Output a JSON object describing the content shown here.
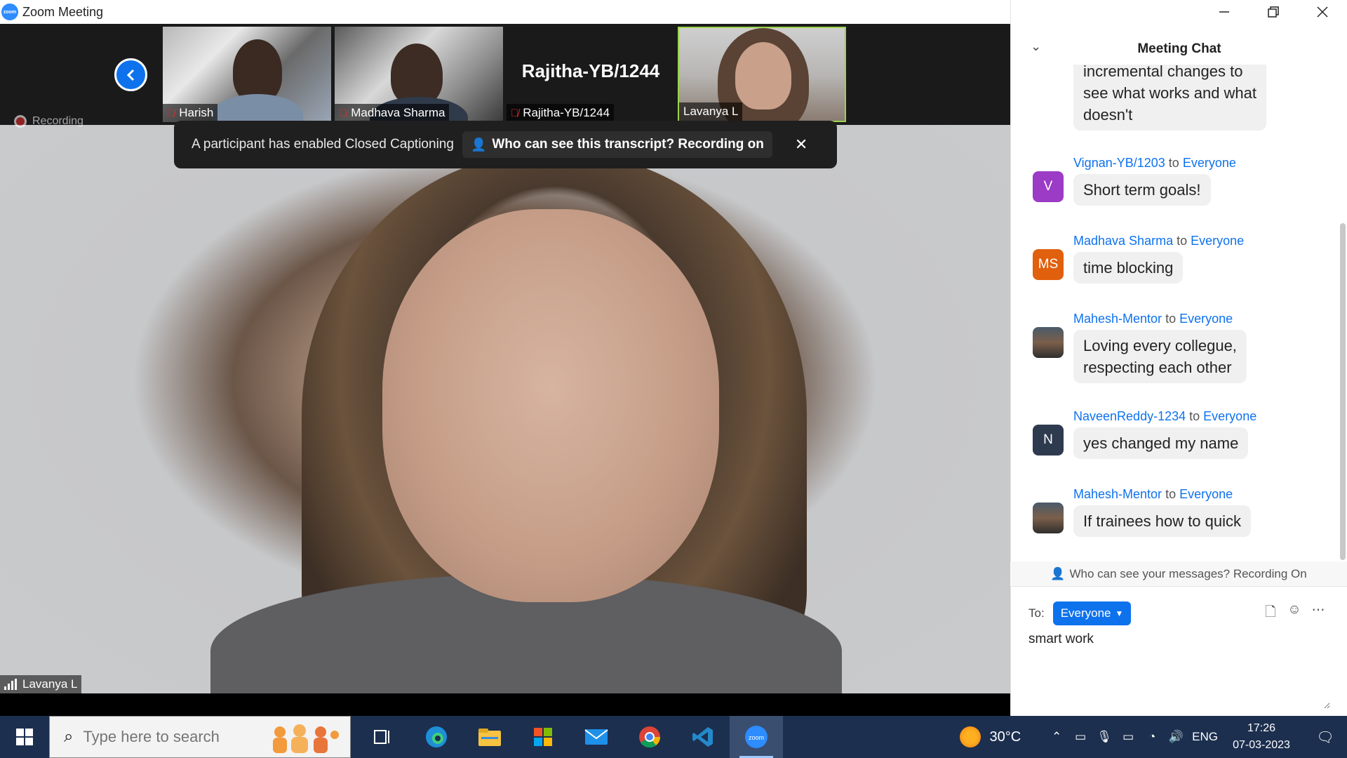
{
  "window": {
    "title": "Zoom Meeting",
    "logo_text": "zoom"
  },
  "participants": [
    {
      "name": "Harish",
      "muted": true
    },
    {
      "name": "Madhava Sharma",
      "muted": true
    },
    {
      "name": "Rajitha-YB/1244",
      "muted": true
    },
    {
      "name": "Lavanya L",
      "muted": false
    }
  ],
  "main_video": {
    "speaker": "Lavanya L",
    "recording_label": "Recording"
  },
  "cc_banner": {
    "text": "A participant has enabled Closed Captioning",
    "pill": "Who can see this transcript? Recording on"
  },
  "chat": {
    "title": "Meeting Chat",
    "messages": [
      {
        "sender": "",
        "to": "",
        "avatar": "",
        "lines": [
          "incremental changes to",
          "see what works  and what",
          "doesn't"
        ]
      },
      {
        "sender": "Vignan-YB/1203",
        "to": "Everyone",
        "avatar": "V",
        "avatar_color": "#9b3bc6",
        "lines": [
          "Short term goals!"
        ]
      },
      {
        "sender": "Madhava Sharma",
        "to": "Everyone",
        "avatar": "MS",
        "avatar_color": "#e0600e",
        "lines": [
          "time blocking"
        ]
      },
      {
        "sender": "Mahesh-Mentor",
        "to": "Everyone",
        "avatar": "",
        "lines": [
          "Loving every collegue,",
          "respecting each other"
        ]
      },
      {
        "sender": "NaveenReddy-1234",
        "to": "Everyone",
        "avatar": "N",
        "avatar_color": "#2e3a4e",
        "lines": [
          "yes changed my name"
        ]
      },
      {
        "sender": "Mahesh-Mentor",
        "to": "Everyone",
        "avatar": "",
        "lines": [
          "If trainees how to quick"
        ]
      }
    ],
    "to_word": "to",
    "privacy_note": "Who can see your messages? Recording On",
    "to_label": "To:",
    "to_value": "Everyone",
    "input_value": "smart work"
  },
  "taskbar": {
    "search_placeholder": "Type here to search",
    "weather": "30°C",
    "language": "ENG",
    "time": "17:26",
    "date": "07-03-2023"
  },
  "colors": {
    "accent": "#0e72ed",
    "taskbar": "#1c2f4f",
    "active_speaker_border": "#9bd34a"
  }
}
